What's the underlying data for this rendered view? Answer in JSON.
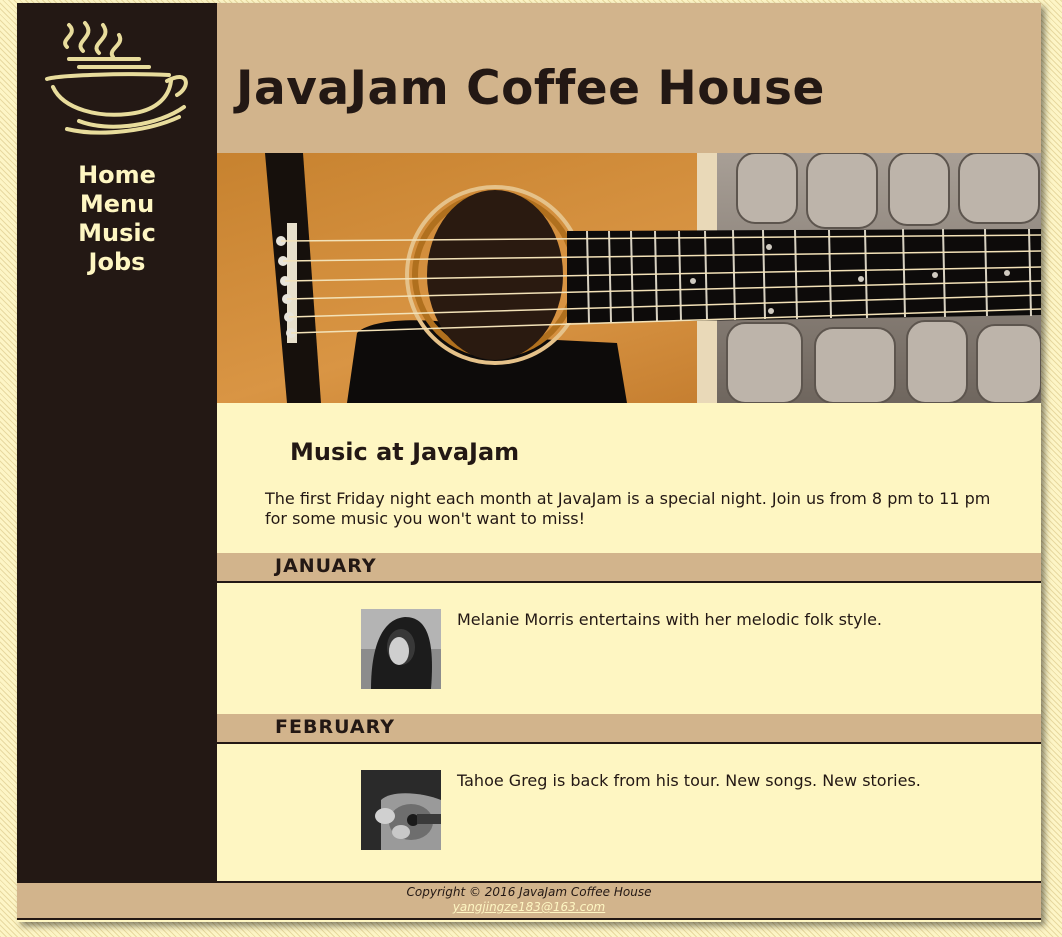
{
  "site": {
    "title": "JavaJam Coffee House"
  },
  "nav": {
    "items": [
      "Home",
      "Menu",
      "Music",
      "Jobs"
    ]
  },
  "main": {
    "heading": "Music at JavaJam",
    "intro": "The first Friday night each month at JavaJam is a special night. Join us from 8 pm to 11 pm for some music you won't want to miss!",
    "events": [
      {
        "month": "JANUARY",
        "description": "Melanie Morris entertains with her melodic folk style."
      },
      {
        "month": "FEBRUARY",
        "description": "Tahoe Greg is back from his tour. New songs. New stories."
      }
    ]
  },
  "footer": {
    "copyright": "Copyright © 2016 JavaJam Coffee House",
    "email": "yangjingze183@163.com"
  },
  "colors": {
    "dark_brown": "#231814",
    "tan": "#d2b48c",
    "cream": "#fef6c2"
  },
  "icons": {
    "logo": "coffee-cup-icon"
  }
}
